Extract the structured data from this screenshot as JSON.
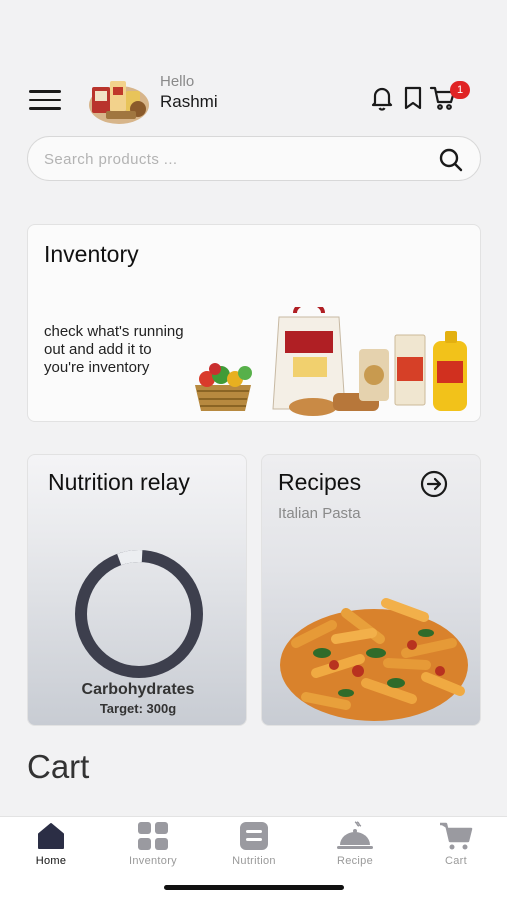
{
  "header": {
    "hello": "Hello",
    "user_name": "Rashmi",
    "cart_badge": "1"
  },
  "search": {
    "placeholder": "Search products ...",
    "value": ""
  },
  "inventory_card": {
    "title": "Inventory",
    "description": "check what's running out and add it to you're inventory"
  },
  "nutrition_card": {
    "title": "Nutrition relay",
    "nutrient": "Carbohydrates",
    "target": "Target: 300g",
    "progress_fraction": 0.03
  },
  "recipes_card": {
    "title": "Recipes",
    "subtitle": "Italian Pasta"
  },
  "cart_section": {
    "title": "Cart"
  },
  "tabbar": {
    "items": [
      {
        "label": "Home",
        "icon": "home-icon",
        "active": true
      },
      {
        "label": "Inventory",
        "icon": "grid-icon",
        "active": false
      },
      {
        "label": "Nutrition",
        "icon": "nutrition-icon",
        "active": false
      },
      {
        "label": "Recipe",
        "icon": "cloche-icon",
        "active": false
      },
      {
        "label": "Cart",
        "icon": "cart-icon",
        "active": false
      }
    ]
  },
  "colors": {
    "badge": "#e02424",
    "ring": "#3d3f4d",
    "active_tab": "#2b2e45"
  }
}
